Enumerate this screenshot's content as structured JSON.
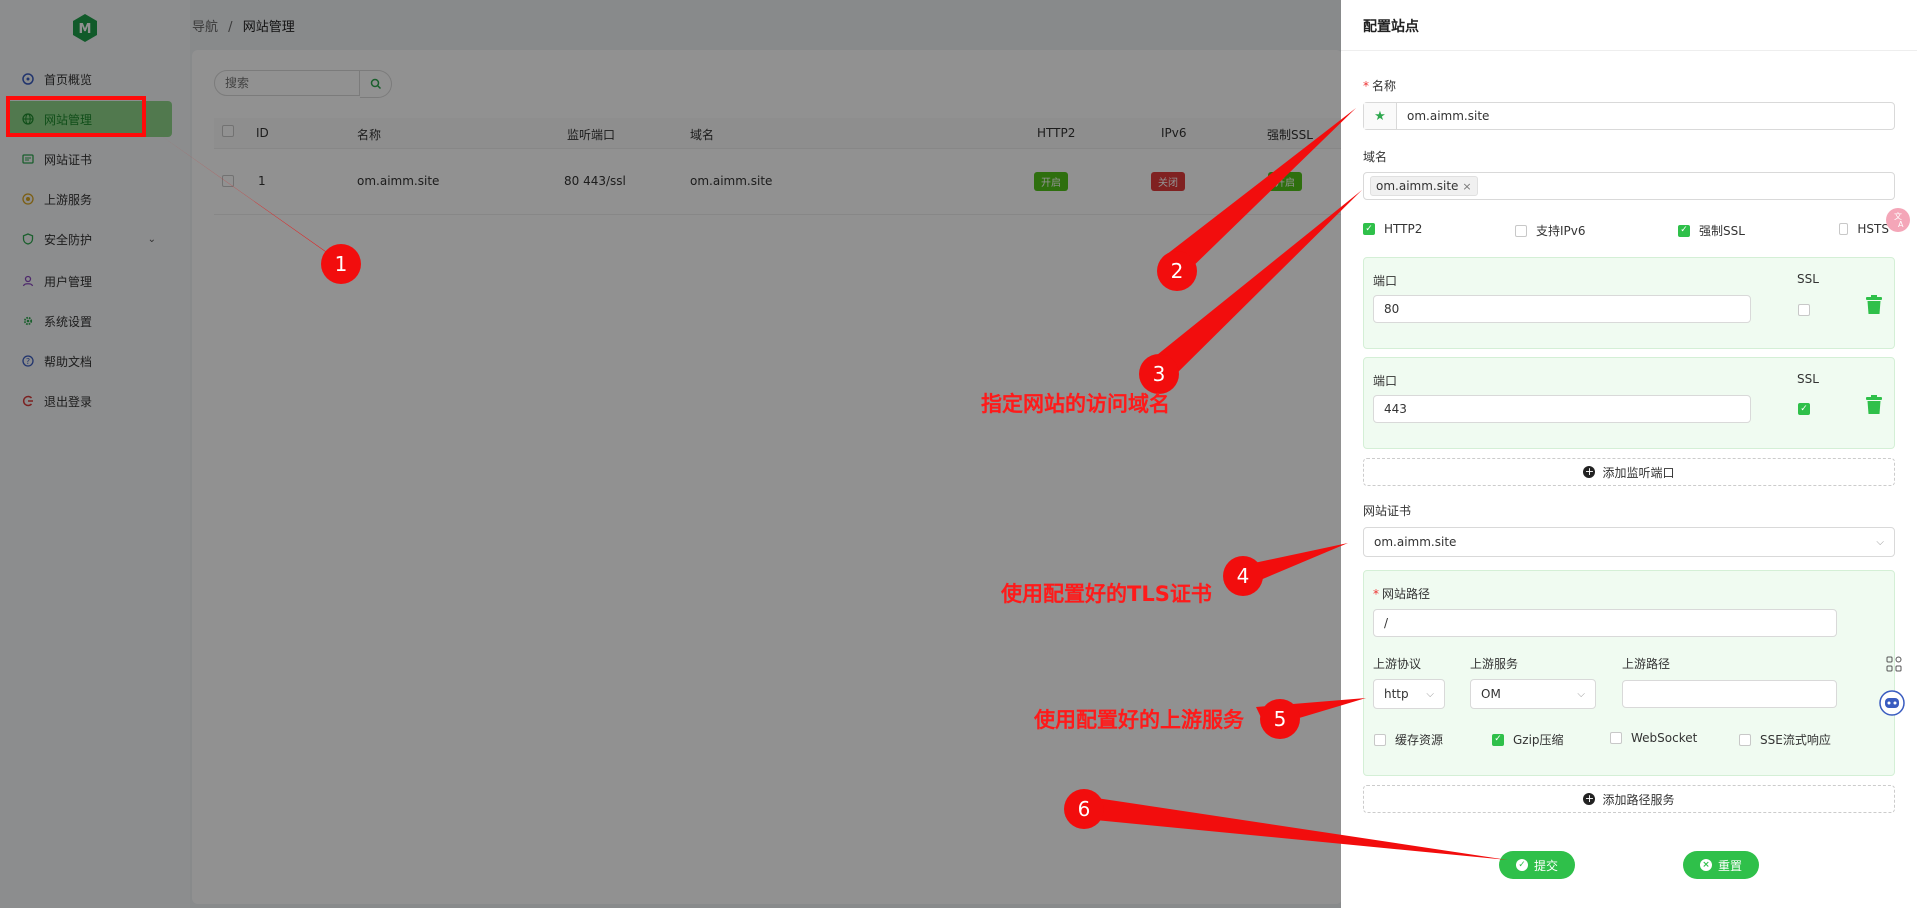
{
  "breadcrumb": {
    "root": "导航",
    "separator": "/",
    "current": "网站管理"
  },
  "sidebar": {
    "items": [
      {
        "label": "首页概览",
        "icon": "dashboard-icon"
      },
      {
        "label": "网站管理",
        "icon": "globe-icon",
        "active": true
      },
      {
        "label": "网站证书",
        "icon": "certificate-icon"
      },
      {
        "label": "上游服务",
        "icon": "upstream-icon"
      },
      {
        "label": "安全防护",
        "icon": "shield-icon",
        "expandable": true
      },
      {
        "label": "用户管理",
        "icon": "user-icon"
      },
      {
        "label": "系统设置",
        "icon": "gear-icon"
      },
      {
        "label": "帮助文档",
        "icon": "help-icon"
      },
      {
        "label": "退出登录",
        "icon": "logout-icon"
      }
    ]
  },
  "search": {
    "placeholder": "搜索"
  },
  "table": {
    "columns": [
      "ID",
      "名称",
      "监听端口",
      "域名",
      "HTTP2",
      "IPv6",
      "强制SSL"
    ],
    "rows": [
      {
        "id": "1",
        "name": "om.aimm.site",
        "ports": "80 443/ssl",
        "domain": "om.aimm.site",
        "http2": "开启",
        "ipv6": "关闭",
        "force_ssl": "开启"
      }
    ]
  },
  "drawer": {
    "title": "配置站点",
    "name_label": "名称",
    "name_value": "om.aimm.site",
    "domain_label": "域名",
    "domain_tag": "om.aimm.site",
    "options": [
      {
        "label": "HTTP2",
        "checked": true
      },
      {
        "label": "支持IPv6",
        "checked": false
      },
      {
        "label": "强制SSL",
        "checked": true
      },
      {
        "label": "HSTS",
        "checked": false
      }
    ],
    "ports": [
      {
        "port_label": "端口",
        "value": "80",
        "ssl_label": "SSL",
        "ssl": false
      },
      {
        "port_label": "端口",
        "value": "443",
        "ssl_label": "SSL",
        "ssl": true
      }
    ],
    "add_port_label": "添加监听端口",
    "cert_label": "网站证书",
    "cert_value": "om.aimm.site",
    "path_label": "网站路径",
    "path_value": "/",
    "upstream_protocol_label": "上游协议",
    "upstream_protocol_value": "http",
    "upstream_service_label": "上游服务",
    "upstream_service_value": "OM",
    "upstream_path_label": "上游路径",
    "upstream_path_value": "",
    "path_options": [
      {
        "label": "缓存资源",
        "checked": false
      },
      {
        "label": "Gzip压缩",
        "checked": true
      },
      {
        "label": "WebSocket",
        "checked": false
      },
      {
        "label": "SSE流式响应",
        "checked": false
      }
    ],
    "add_path_label": "添加路径服务",
    "submit_label": "提交",
    "reset_label": "重置"
  },
  "annotations": {
    "badges": [
      "1",
      "2",
      "3",
      "4",
      "5",
      "6"
    ],
    "callout_domain": "指定网站的访问域名",
    "callout_cert": "使用配置好的TLS证书",
    "callout_upstream": "使用配置好的上游服务"
  },
  "colors": {
    "accent": "#2fc04a",
    "annotation": "#f20d0d",
    "danger_tag": "#e23b3b",
    "active_nav": "#8fd58a"
  }
}
